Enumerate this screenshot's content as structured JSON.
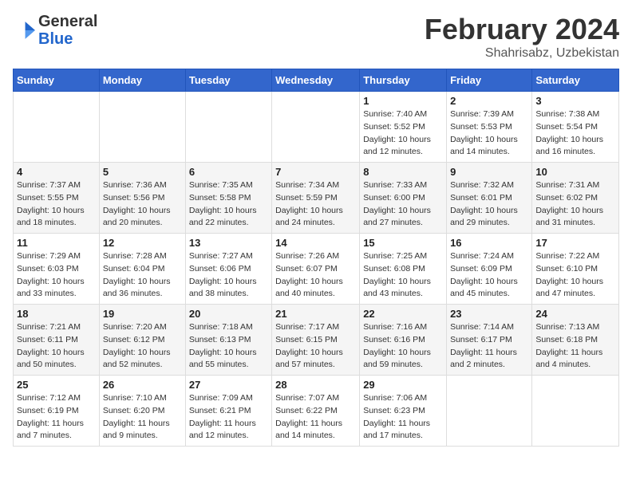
{
  "logo": {
    "general": "General",
    "blue": "Blue"
  },
  "header": {
    "month": "February 2024",
    "location": "Shahrisabz, Uzbekistan"
  },
  "weekdays": [
    "Sunday",
    "Monday",
    "Tuesday",
    "Wednesday",
    "Thursday",
    "Friday",
    "Saturday"
  ],
  "weeks": [
    [
      {
        "day": "",
        "info": ""
      },
      {
        "day": "",
        "info": ""
      },
      {
        "day": "",
        "info": ""
      },
      {
        "day": "",
        "info": ""
      },
      {
        "day": "1",
        "info": "Sunrise: 7:40 AM\nSunset: 5:52 PM\nDaylight: 10 hours\nand 12 minutes."
      },
      {
        "day": "2",
        "info": "Sunrise: 7:39 AM\nSunset: 5:53 PM\nDaylight: 10 hours\nand 14 minutes."
      },
      {
        "day": "3",
        "info": "Sunrise: 7:38 AM\nSunset: 5:54 PM\nDaylight: 10 hours\nand 16 minutes."
      }
    ],
    [
      {
        "day": "4",
        "info": "Sunrise: 7:37 AM\nSunset: 5:55 PM\nDaylight: 10 hours\nand 18 minutes."
      },
      {
        "day": "5",
        "info": "Sunrise: 7:36 AM\nSunset: 5:56 PM\nDaylight: 10 hours\nand 20 minutes."
      },
      {
        "day": "6",
        "info": "Sunrise: 7:35 AM\nSunset: 5:58 PM\nDaylight: 10 hours\nand 22 minutes."
      },
      {
        "day": "7",
        "info": "Sunrise: 7:34 AM\nSunset: 5:59 PM\nDaylight: 10 hours\nand 24 minutes."
      },
      {
        "day": "8",
        "info": "Sunrise: 7:33 AM\nSunset: 6:00 PM\nDaylight: 10 hours\nand 27 minutes."
      },
      {
        "day": "9",
        "info": "Sunrise: 7:32 AM\nSunset: 6:01 PM\nDaylight: 10 hours\nand 29 minutes."
      },
      {
        "day": "10",
        "info": "Sunrise: 7:31 AM\nSunset: 6:02 PM\nDaylight: 10 hours\nand 31 minutes."
      }
    ],
    [
      {
        "day": "11",
        "info": "Sunrise: 7:29 AM\nSunset: 6:03 PM\nDaylight: 10 hours\nand 33 minutes."
      },
      {
        "day": "12",
        "info": "Sunrise: 7:28 AM\nSunset: 6:04 PM\nDaylight: 10 hours\nand 36 minutes."
      },
      {
        "day": "13",
        "info": "Sunrise: 7:27 AM\nSunset: 6:06 PM\nDaylight: 10 hours\nand 38 minutes."
      },
      {
        "day": "14",
        "info": "Sunrise: 7:26 AM\nSunset: 6:07 PM\nDaylight: 10 hours\nand 40 minutes."
      },
      {
        "day": "15",
        "info": "Sunrise: 7:25 AM\nSunset: 6:08 PM\nDaylight: 10 hours\nand 43 minutes."
      },
      {
        "day": "16",
        "info": "Sunrise: 7:24 AM\nSunset: 6:09 PM\nDaylight: 10 hours\nand 45 minutes."
      },
      {
        "day": "17",
        "info": "Sunrise: 7:22 AM\nSunset: 6:10 PM\nDaylight: 10 hours\nand 47 minutes."
      }
    ],
    [
      {
        "day": "18",
        "info": "Sunrise: 7:21 AM\nSunset: 6:11 PM\nDaylight: 10 hours\nand 50 minutes."
      },
      {
        "day": "19",
        "info": "Sunrise: 7:20 AM\nSunset: 6:12 PM\nDaylight: 10 hours\nand 52 minutes."
      },
      {
        "day": "20",
        "info": "Sunrise: 7:18 AM\nSunset: 6:13 PM\nDaylight: 10 hours\nand 55 minutes."
      },
      {
        "day": "21",
        "info": "Sunrise: 7:17 AM\nSunset: 6:15 PM\nDaylight: 10 hours\nand 57 minutes."
      },
      {
        "day": "22",
        "info": "Sunrise: 7:16 AM\nSunset: 6:16 PM\nDaylight: 10 hours\nand 59 minutes."
      },
      {
        "day": "23",
        "info": "Sunrise: 7:14 AM\nSunset: 6:17 PM\nDaylight: 11 hours\nand 2 minutes."
      },
      {
        "day": "24",
        "info": "Sunrise: 7:13 AM\nSunset: 6:18 PM\nDaylight: 11 hours\nand 4 minutes."
      }
    ],
    [
      {
        "day": "25",
        "info": "Sunrise: 7:12 AM\nSunset: 6:19 PM\nDaylight: 11 hours\nand 7 minutes."
      },
      {
        "day": "26",
        "info": "Sunrise: 7:10 AM\nSunset: 6:20 PM\nDaylight: 11 hours\nand 9 minutes."
      },
      {
        "day": "27",
        "info": "Sunrise: 7:09 AM\nSunset: 6:21 PM\nDaylight: 11 hours\nand 12 minutes."
      },
      {
        "day": "28",
        "info": "Sunrise: 7:07 AM\nSunset: 6:22 PM\nDaylight: 11 hours\nand 14 minutes."
      },
      {
        "day": "29",
        "info": "Sunrise: 7:06 AM\nSunset: 6:23 PM\nDaylight: 11 hours\nand 17 minutes."
      },
      {
        "day": "",
        "info": ""
      },
      {
        "day": "",
        "info": ""
      }
    ]
  ]
}
